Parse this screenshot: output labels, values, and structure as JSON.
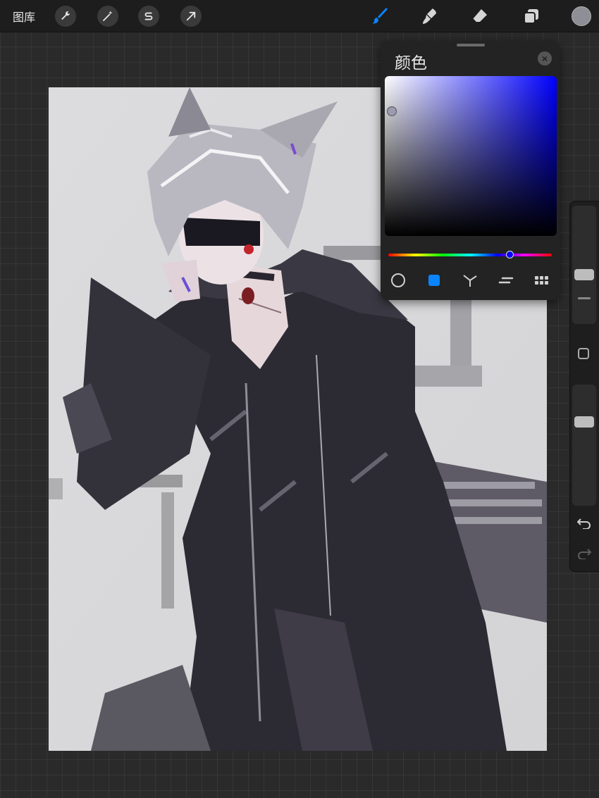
{
  "toolbar": {
    "gallery_label": "图库",
    "left_icons": [
      "wrench-icon",
      "magic-wand-icon",
      "selection-s-icon",
      "transform-arrow-icon"
    ],
    "right_icons": [
      "brush-icon",
      "smudge-icon",
      "eraser-icon",
      "layers-icon"
    ],
    "active_tool": "brush",
    "active_color": "#0a84ff",
    "current_color": "#8e8e96"
  },
  "color_panel": {
    "title": "颜色",
    "close_icon": "close-icon",
    "hue_color": "#0000ff",
    "modes": [
      "disc",
      "classic",
      "harmony",
      "value",
      "palettes"
    ],
    "selected_mode": "classic"
  },
  "sidebar": {
    "icons": [
      "brush-size-slider",
      "modify-square-icon",
      "opacity-slider",
      "undo-icon",
      "redo-icon"
    ]
  },
  "canvas": {
    "background": "#d8d8da"
  }
}
